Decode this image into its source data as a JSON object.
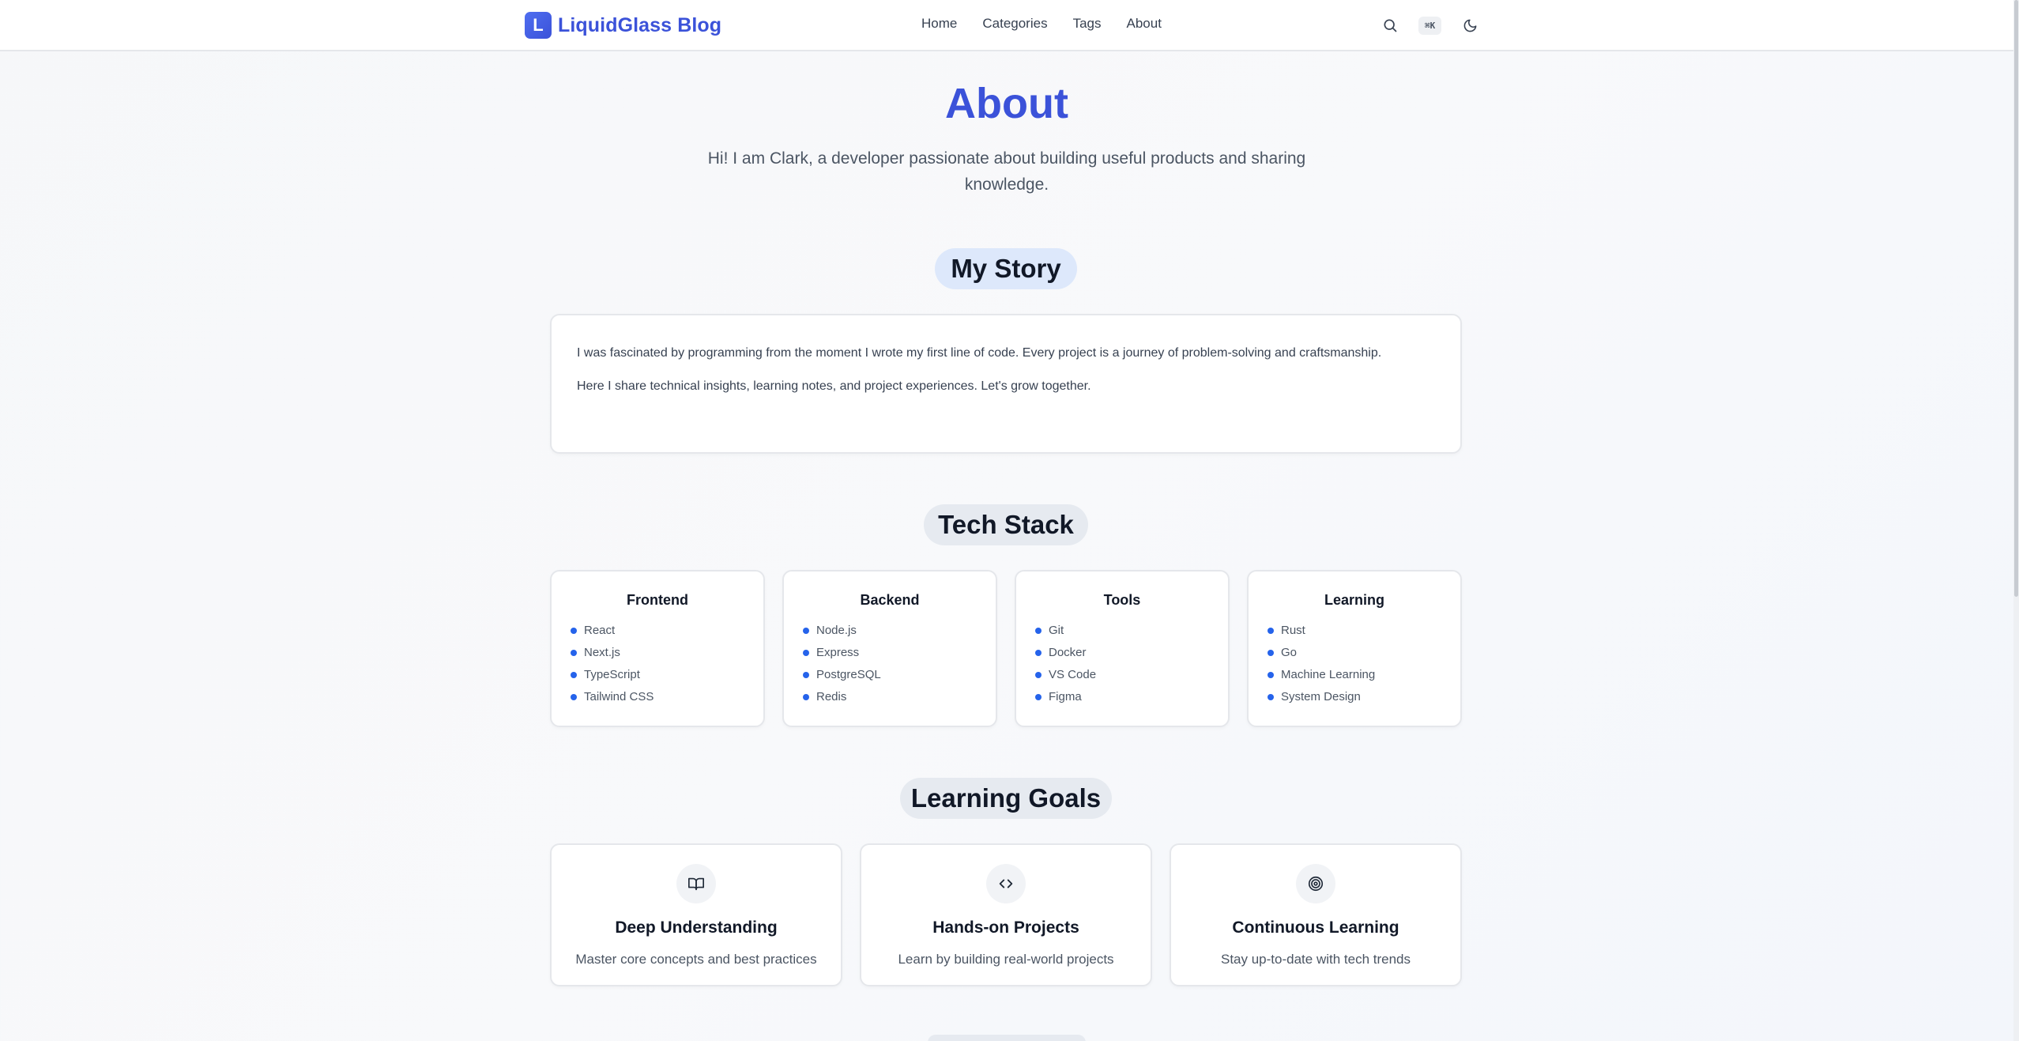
{
  "navbar": {
    "logo_letter": "L",
    "brand": "LiquidGlass Blog",
    "links": [
      "Home",
      "Categories",
      "Tags",
      "About"
    ],
    "shortcut": "⌘K",
    "icons": {
      "search": "search-icon",
      "theme": "moon-icon"
    }
  },
  "hero": {
    "title": "About",
    "intro": "Hi! I am Clark, a developer passionate about building useful products and sharing knowledge."
  },
  "story": {
    "heading": "My Story",
    "paragraphs": [
      "I was fascinated by programming from the moment I wrote my first line of code. Every project is a journey of problem-solving and craftsmanship.",
      "Here I share technical insights, learning notes, and project experiences. Let's grow together."
    ]
  },
  "tech_stack": {
    "heading": "Tech Stack",
    "groups": [
      {
        "title": "Frontend",
        "items": [
          "React",
          "Next.js",
          "TypeScript",
          "Tailwind CSS"
        ]
      },
      {
        "title": "Backend",
        "items": [
          "Node.js",
          "Express",
          "PostgreSQL",
          "Redis"
        ]
      },
      {
        "title": "Tools",
        "items": [
          "Git",
          "Docker",
          "VS Code",
          "Figma"
        ]
      },
      {
        "title": "Learning",
        "items": [
          "Rust",
          "Go",
          "Machine Learning",
          "System Design"
        ]
      }
    ],
    "bullet_color": "#2563eb"
  },
  "goals": {
    "heading": "Learning Goals",
    "items": [
      {
        "icon": "book-open-icon",
        "title": "Deep Understanding",
        "desc": "Master core concepts and best practices"
      },
      {
        "icon": "code-icon",
        "title": "Hands-on Projects",
        "desc": "Learn by building real-world projects"
      },
      {
        "icon": "target-icon",
        "title": "Continuous Learning",
        "desc": "Stay up-to-date with tech trends"
      }
    ]
  },
  "colors": {
    "accent": "#3b52d9",
    "pill_blue": "#dde8fb",
    "pill_gray": "#e6eaf0"
  }
}
